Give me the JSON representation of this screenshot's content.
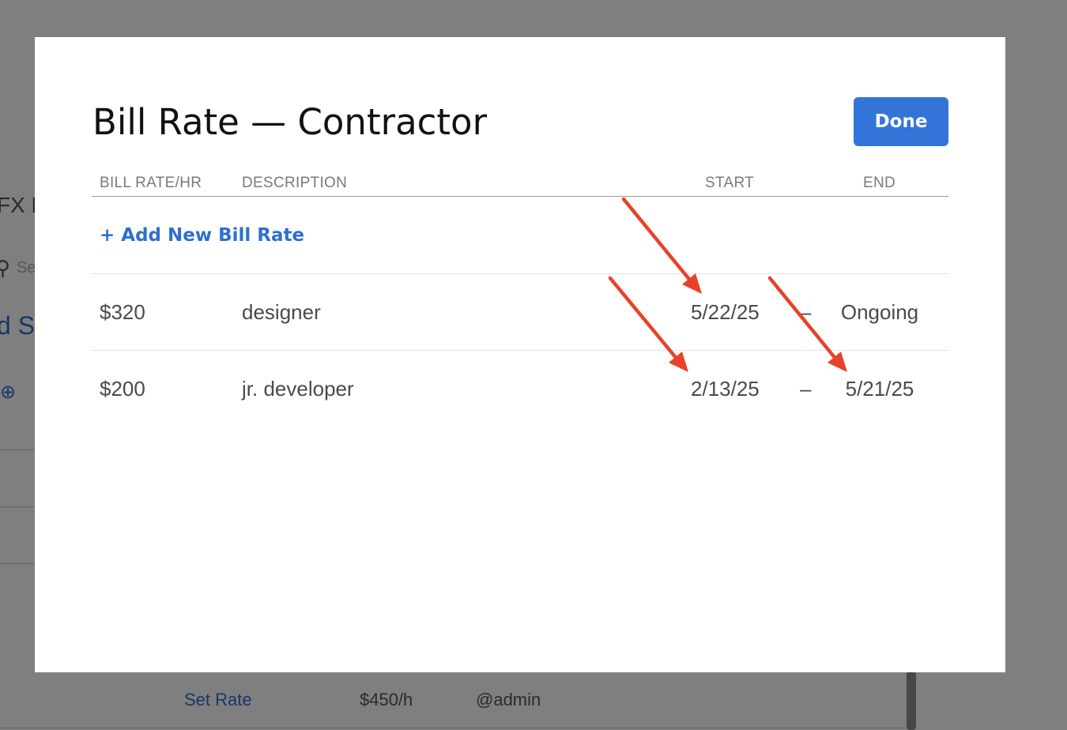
{
  "background": {
    "fragment_1": "FX F",
    "fragment_2": "Se",
    "fragment_3": "d St",
    "bottom_row": {
      "link": "Set Rate",
      "rate": "$450/h",
      "user": "@admin"
    }
  },
  "modal": {
    "title": "Bill Rate — Contractor",
    "done_label": "Done",
    "columns": {
      "rate": "BILL RATE/HR",
      "description": "DESCRIPTION",
      "start": "START",
      "end": "END"
    },
    "add_label": "+ Add New Bill Rate",
    "rows": [
      {
        "rate": "$320",
        "description": "designer",
        "start": "5/22/25",
        "separator": "–",
        "end": "Ongoing"
      },
      {
        "rate": "$200",
        "description": "jr. developer",
        "start": "2/13/25",
        "separator": "–",
        "end": "5/21/25"
      }
    ]
  },
  "colors": {
    "accent": "#3374d9",
    "link": "#2f6fcf",
    "annotation_arrow": "#e8412a",
    "overlay": "rgba(0,0,0,0.5)"
  }
}
